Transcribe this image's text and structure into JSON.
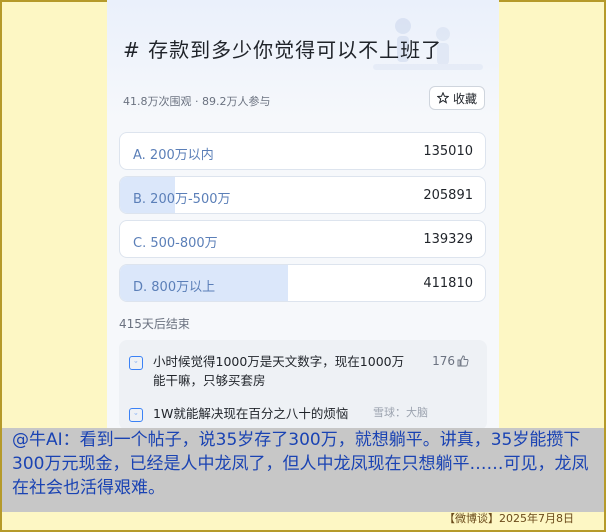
{
  "topic": {
    "title": "# 存款到多少你觉得可以不上班了",
    "stats": "41.8万次围观 · 89.2万人参与",
    "collect_label": "收藏"
  },
  "poll": {
    "options": [
      {
        "label": "A. 200万以内",
        "votes": "135010",
        "fill_fraction": 0.0
      },
      {
        "label": "B. 200万-500万",
        "votes": "205891",
        "fill_fraction": 0.15
      },
      {
        "label": "C. 500-800万",
        "votes": "139329",
        "fill_fraction": 0.0
      },
      {
        "label": "D. 800万以上",
        "votes": "411810",
        "fill_fraction": 0.46
      }
    ],
    "countdown": "415天后结束"
  },
  "comments": [
    {
      "text": "小时候觉得1000万是天文数字，现在1000万能干嘛，只够买套房",
      "likes": "176"
    },
    {
      "text": "1W就能解决现在百分之八十的烦恼",
      "likes": ""
    }
  ],
  "watermark": "雪球：大脑",
  "caption": "@牛AI：看到一个帖子，说35岁存了300万，就想躺平。讲真，35岁能攒下300万元现金，已经是人中龙凤了，但人中龙凤现在只想躺平……可见，龙凤在社会也活得艰难。",
  "credit": "【微博谈】2025年7月8日",
  "colors": {
    "accent": "#1a43b3",
    "poll_fill": "#dbe7fa",
    "page_bg": "#fdf7c4"
  }
}
